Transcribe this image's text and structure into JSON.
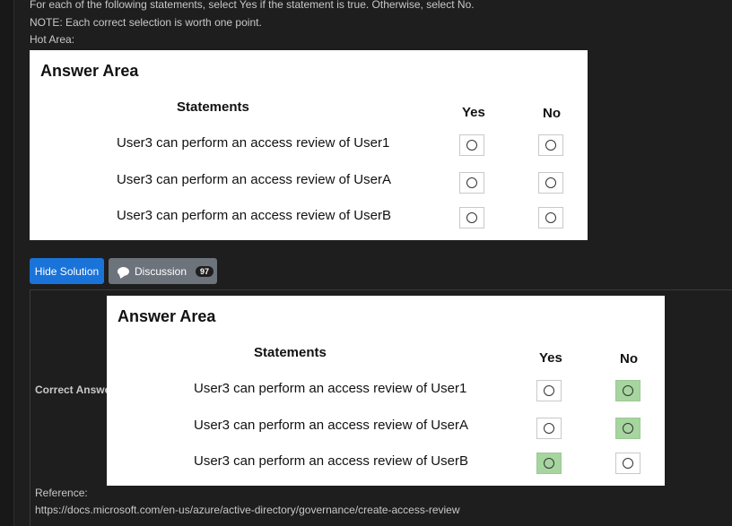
{
  "intro": {
    "line1": "For each of the following statements, select Yes if the statement is true. Otherwise, select No.",
    "line2": "NOTE: Each correct selection is worth one point.",
    "line3": "Hot Area:"
  },
  "question_panel": {
    "title": "Answer Area",
    "statements_header": "Statements",
    "yes_header": "Yes",
    "no_header": "No",
    "rows": [
      {
        "statement": "User3 can perform an access review of User1"
      },
      {
        "statement": "User3 can perform an access review of UserA"
      },
      {
        "statement": "User3 can perform an access review of UserB"
      }
    ]
  },
  "buttons": {
    "hide_solution": "Hide Solution",
    "discussion": "Discussion",
    "discussion_count": "97"
  },
  "solution": {
    "correct_answer_label": "Correct Answer:",
    "title": "Answer Area",
    "statements_header": "Statements",
    "yes_header": "Yes",
    "no_header": "No",
    "rows": [
      {
        "statement": "User3 can perform an access review of User1",
        "answer": "No"
      },
      {
        "statement": "User3 can perform an access review of UserA",
        "answer": "No"
      },
      {
        "statement": "User3 can perform an access review of UserB",
        "answer": "Yes"
      }
    ],
    "reference_label": "Reference:",
    "reference_url": "https://docs.microsoft.com/en-us/azure/active-directory/governance/create-access-review"
  },
  "colors": {
    "selected_answer": "#a6d59f",
    "hide_button": "#1a73d9",
    "discussion_button": "#6c737b"
  }
}
